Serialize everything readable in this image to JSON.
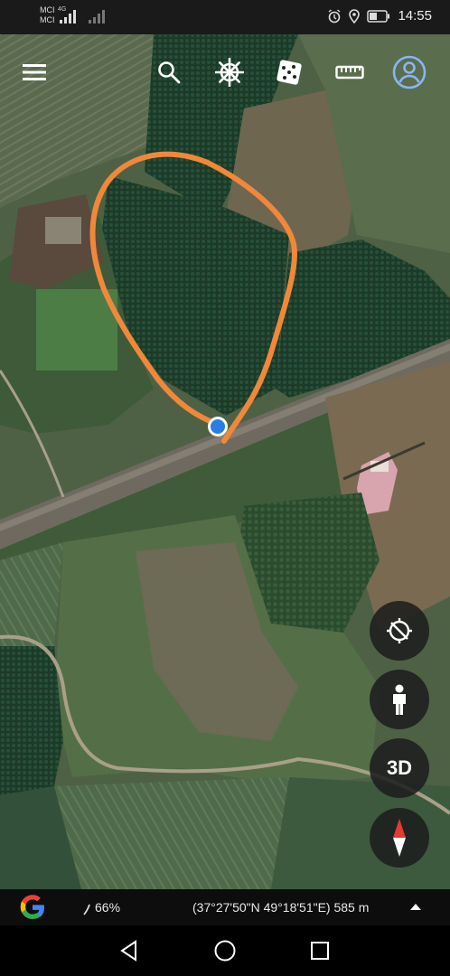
{
  "status_bar": {
    "carrier_1": "MCI",
    "carrier_2": "MCI",
    "network": "4G",
    "time": "14:55"
  },
  "toolbar": {
    "menu_icon": "hamburger-menu-icon",
    "search_icon": "search-icon",
    "voyager_icon": "ship-wheel-icon",
    "feeling_lucky_icon": "dice-icon",
    "measure_icon": "ruler-icon",
    "account_icon": "account-icon"
  },
  "map_controls": {
    "rotate_icon": "compass-reset-icon",
    "pegman_icon": "street-view-person-icon",
    "view_mode_label": "3D",
    "compass_icon": "compass-needle-icon"
  },
  "bottom_bar": {
    "logo_letter": "G",
    "data_usage": "66%",
    "coordinates": "(37°27'50\"N 49°18'51\"E) 585 m"
  },
  "colors": {
    "annotation_stroke": "#f0883a",
    "location_dot": "#2a7de1",
    "toolbar_account": "#8ab4f8",
    "compass_red": "#e53935"
  }
}
